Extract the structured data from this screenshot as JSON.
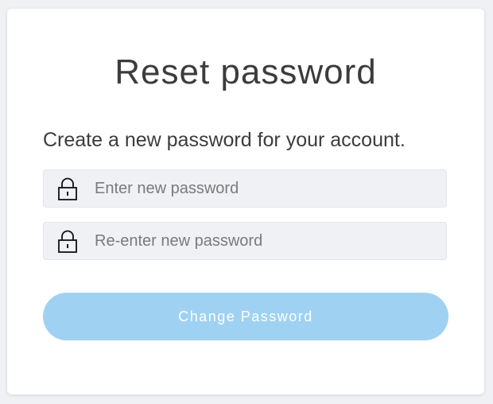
{
  "page": {
    "title": "Reset password",
    "subtitle": "Create a new password for your account."
  },
  "form": {
    "new_password": {
      "placeholder": "Enter new password",
      "value": "",
      "icon": "lock-icon"
    },
    "confirm_password": {
      "placeholder": "Re-enter new password",
      "value": "",
      "icon": "lock-icon"
    },
    "submit_label": "Change Password"
  },
  "colors": {
    "background": "#eff1f5",
    "card": "#ffffff",
    "text": "#3c3c3c",
    "input_background": "#f0f1f5",
    "button": "#9fd2f2",
    "button_text": "#ffffff"
  }
}
